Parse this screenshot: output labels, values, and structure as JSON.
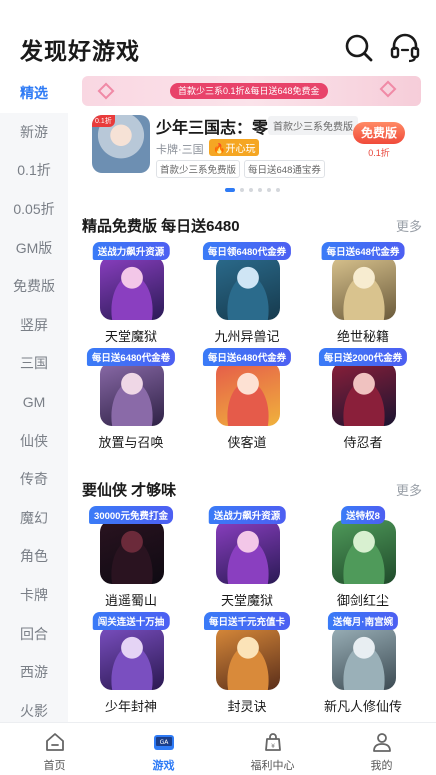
{
  "header": {
    "title": "发现好游戏",
    "search_icon": "search-icon",
    "service_icon": "headset-icon"
  },
  "sidebar": {
    "active_index": 0,
    "items": [
      "精选",
      "新游",
      "0.1折",
      "0.05折",
      "GM版",
      "免费版",
      "竖屏",
      "三国",
      "GM",
      "仙侠",
      "传奇",
      "魔幻",
      "角色",
      "卡牌",
      "回合",
      "西游",
      "火影"
    ]
  },
  "banner": {
    "strip_text": "首款少三系0.1折&每日送648免费金"
  },
  "featured": {
    "thumb_tag": "0.1折",
    "name": "少年三国志：零",
    "desc_tag": "首款少三系免费版",
    "sub": "卡牌·三国",
    "hot_label": "🔥开心玩",
    "chips": [
      "首款少三系免费版",
      "每日送648通宝券"
    ],
    "badge_main": "免费版",
    "badge_sub": "0.1折"
  },
  "carousel": {
    "count": 6,
    "active": 0
  },
  "section1": {
    "title": "精品免费版 每日送6480",
    "more": "更多",
    "games": [
      {
        "badge": "送战力飙升资源",
        "name": "天堂魔狱",
        "palette": [
          "#f3c7e8",
          "#8a3fc0",
          "#2a1a55"
        ]
      },
      {
        "badge": "每日领6480代金券",
        "name": "九州异兽记",
        "palette": [
          "#cfe5f5",
          "#2b6b8c",
          "#163a4d"
        ]
      },
      {
        "badge": "每日送648代金券",
        "name": "绝世秘籍",
        "palette": [
          "#f7ecd0",
          "#d9c38e",
          "#6a5a3b"
        ]
      },
      {
        "badge": "每日送6480代金卷",
        "name": "放置与召唤",
        "palette": [
          "#efd7e6",
          "#8a6aa8",
          "#2e2145"
        ]
      },
      {
        "badge": "每日送6480代金券",
        "name": "侠客道",
        "palette": [
          "#fde1d3",
          "#e55b4a",
          "#f0b23c"
        ]
      },
      {
        "badge": "每日送2000代金券",
        "name": "侍忍者",
        "palette": [
          "#f0c2c0",
          "#8a1f3a",
          "#1b1430"
        ]
      }
    ]
  },
  "section2": {
    "title": "要仙侠 才够味",
    "more": "更多",
    "games": [
      {
        "badge": "30000元免费打金",
        "name": "逍遥蜀山",
        "palette": [
          "#6b2a3a",
          "#2a1320",
          "#0e0a12"
        ]
      },
      {
        "badge": "送战力飙升资源",
        "name": "天堂魔狱",
        "palette": [
          "#f3c7e8",
          "#8a3fc0",
          "#2a1a55"
        ]
      },
      {
        "badge": "送特权8",
        "name": "御剑红尘",
        "palette": [
          "#d8f0d0",
          "#4f9a5a",
          "#1f4a2a"
        ]
      },
      {
        "badge": "闯关连送十万抽",
        "name": "少年封神",
        "palette": [
          "#e5d4f5",
          "#7a4fc0",
          "#2a1850"
        ]
      },
      {
        "badge": "每日送千元充值卡",
        "name": "封灵诀",
        "palette": [
          "#fbe3b8",
          "#d98a3a",
          "#5a2e1a"
        ]
      },
      {
        "badge": "送俺月·南宫婉",
        "name": "新凡人修仙传",
        "palette": [
          "#e8eef2",
          "#9ab0b8",
          "#3c4a52"
        ]
      }
    ]
  },
  "tabbar": {
    "active_index": 1,
    "items": [
      {
        "label": "首页",
        "icon": "home-icon"
      },
      {
        "label": "游戏",
        "icon": "gamepad-icon"
      },
      {
        "label": "福利中心",
        "icon": "gift-bag-icon"
      },
      {
        "label": "我的",
        "icon": "user-icon"
      }
    ]
  }
}
